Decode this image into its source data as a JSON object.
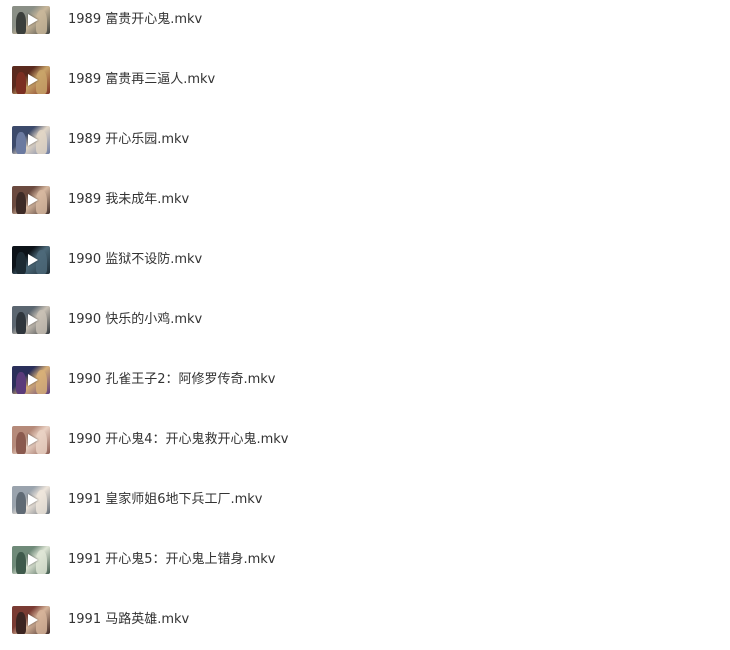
{
  "files": [
    {
      "name": "1989 富贵开心鬼.mkv",
      "thumb_colors": [
        "#8a8f86",
        "#c9b79a",
        "#3b3f3c"
      ],
      "icon": "play-icon"
    },
    {
      "name": "1989 富贵再三逼人.mkv",
      "thumb_colors": [
        "#5a2a1e",
        "#c9a46a",
        "#7b2f22"
      ],
      "icon": "play-icon"
    },
    {
      "name": "1989 开心乐园.mkv",
      "thumb_colors": [
        "#3c4a6b",
        "#e2d6c6",
        "#6b7aa0"
      ],
      "icon": "play-icon"
    },
    {
      "name": "1989 我未成年.mkv",
      "thumb_colors": [
        "#6b4a3f",
        "#d7b8a0",
        "#3d2b27"
      ],
      "icon": "play-icon"
    },
    {
      "name": "1990 监狱不设防.mkv",
      "thumb_colors": [
        "#0c1218",
        "#4d6a7a",
        "#1c2a33"
      ],
      "icon": "play-icon"
    },
    {
      "name": "1990 快乐的小鸡.mkv",
      "thumb_colors": [
        "#5b6670",
        "#c9c1b5",
        "#2f363c"
      ],
      "icon": "play-icon"
    },
    {
      "name": "1990 孔雀王子2：阿修罗传奇.mkv",
      "thumb_colors": [
        "#2a2f5a",
        "#d8b078",
        "#5a3b7a"
      ],
      "icon": "play-icon"
    },
    {
      "name": "1990 开心鬼4：开心鬼救开心鬼.mkv",
      "thumb_colors": [
        "#b58a7a",
        "#ead2c4",
        "#8a5a4f"
      ],
      "icon": "play-icon"
    },
    {
      "name": "1991 皇家师姐6地下兵工厂.mkv",
      "thumb_colors": [
        "#9aa3ad",
        "#efe6dc",
        "#606a74"
      ],
      "icon": "play-icon"
    },
    {
      "name": "1991 开心鬼5：开心鬼上错身.mkv",
      "thumb_colors": [
        "#6f8a79",
        "#dfe6d6",
        "#3f5a4c"
      ],
      "icon": "play-icon"
    },
    {
      "name": "1991 马路英雄.mkv",
      "thumb_colors": [
        "#7a3b33",
        "#d6b49a",
        "#3c2522"
      ],
      "icon": "play-icon"
    }
  ]
}
